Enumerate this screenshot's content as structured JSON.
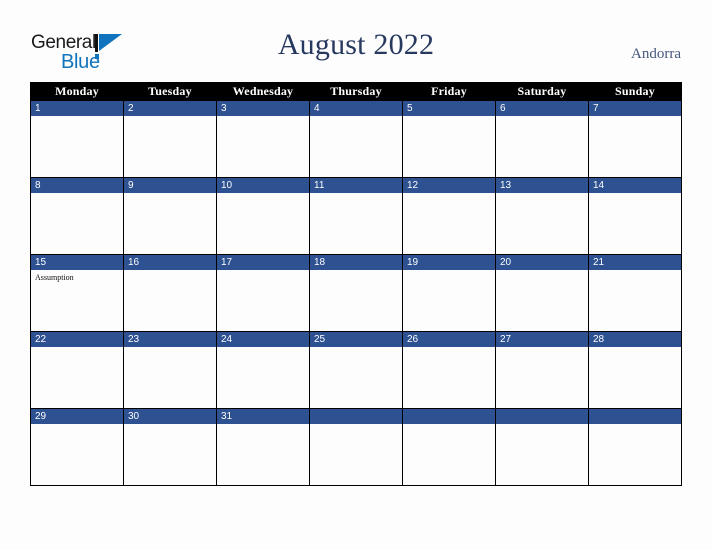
{
  "brand": {
    "name_part1": "General",
    "name_part2": "Blue",
    "mark": "triangle-logo-icon"
  },
  "header": {
    "title": "August 2022",
    "country": "Andorra"
  },
  "calendar": {
    "weekday_headers": [
      "Monday",
      "Tuesday",
      "Wednesday",
      "Thursday",
      "Friday",
      "Saturday",
      "Sunday"
    ],
    "colors": {
      "day_header_blue": "#2d5191",
      "weekday_header_bg": "#000000",
      "weekday_header_text": "#ffffff",
      "title_text": "#27395e",
      "country_text": "#46577e",
      "brand_blue": "#1073bd",
      "page_bg": "#fdfdfd",
      "cell_bg": "#fdfdfd",
      "grid_line": "#000000"
    },
    "weeks": [
      [
        {
          "day": "1",
          "events": []
        },
        {
          "day": "2",
          "events": []
        },
        {
          "day": "3",
          "events": []
        },
        {
          "day": "4",
          "events": []
        },
        {
          "day": "5",
          "events": []
        },
        {
          "day": "6",
          "events": []
        },
        {
          "day": "7",
          "events": []
        }
      ],
      [
        {
          "day": "8",
          "events": []
        },
        {
          "day": "9",
          "events": []
        },
        {
          "day": "10",
          "events": []
        },
        {
          "day": "11",
          "events": []
        },
        {
          "day": "12",
          "events": []
        },
        {
          "day": "13",
          "events": []
        },
        {
          "day": "14",
          "events": []
        }
      ],
      [
        {
          "day": "15",
          "events": [
            "Assumption"
          ]
        },
        {
          "day": "16",
          "events": []
        },
        {
          "day": "17",
          "events": []
        },
        {
          "day": "18",
          "events": []
        },
        {
          "day": "19",
          "events": []
        },
        {
          "day": "20",
          "events": []
        },
        {
          "day": "21",
          "events": []
        }
      ],
      [
        {
          "day": "22",
          "events": []
        },
        {
          "day": "23",
          "events": []
        },
        {
          "day": "24",
          "events": []
        },
        {
          "day": "25",
          "events": []
        },
        {
          "day": "26",
          "events": []
        },
        {
          "day": "27",
          "events": []
        },
        {
          "day": "28",
          "events": []
        }
      ],
      [
        {
          "day": "29",
          "events": []
        },
        {
          "day": "30",
          "events": []
        },
        {
          "day": "31",
          "events": []
        },
        {
          "day": "",
          "events": []
        },
        {
          "day": "",
          "events": []
        },
        {
          "day": "",
          "events": []
        },
        {
          "day": "",
          "events": []
        }
      ]
    ]
  }
}
